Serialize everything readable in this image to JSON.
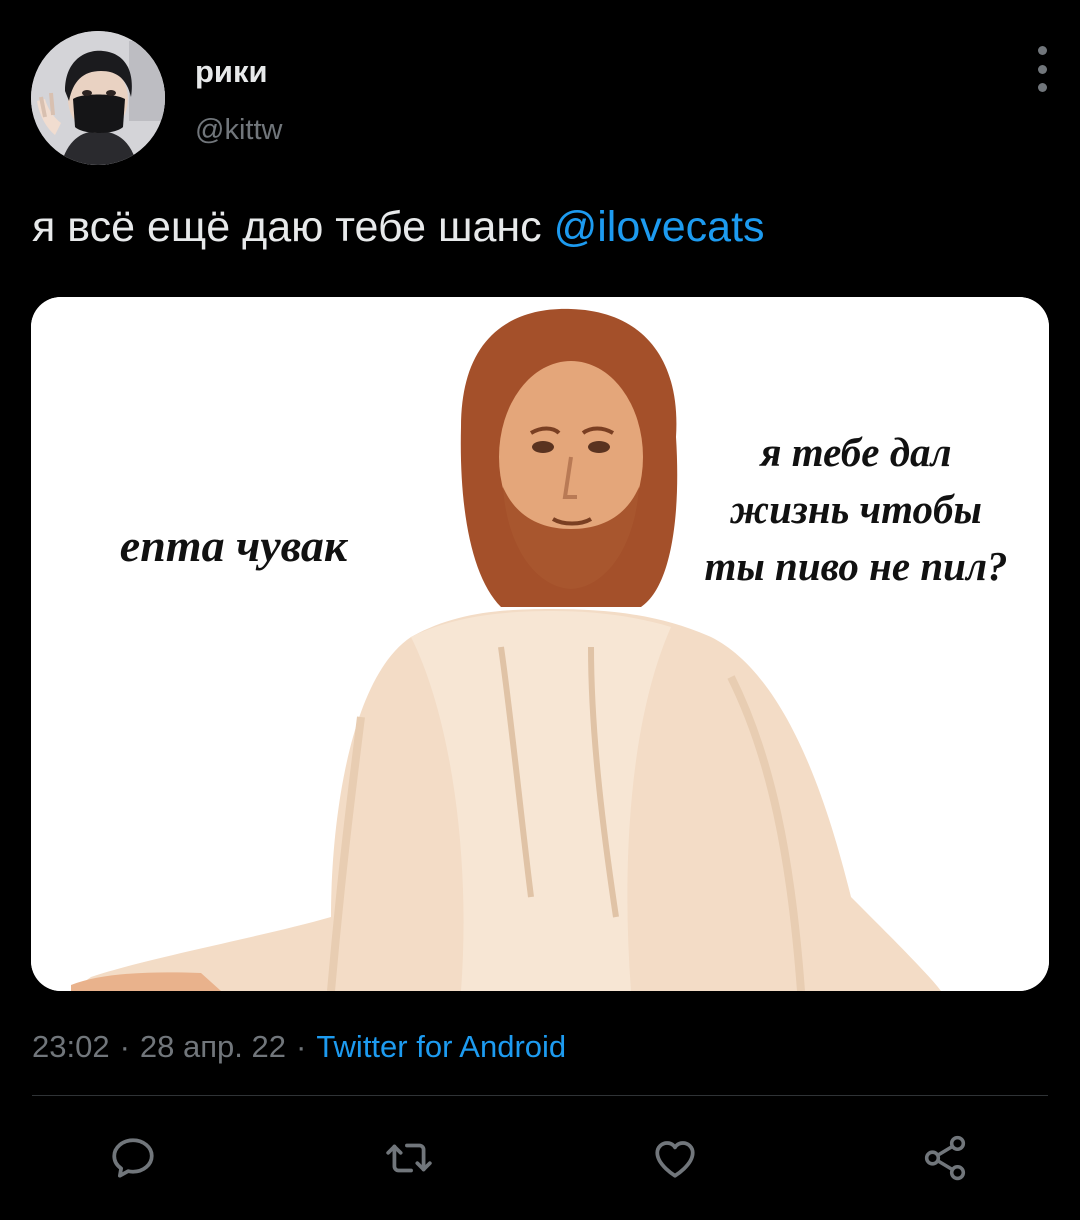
{
  "author": {
    "display_name": "рики",
    "handle": "@kittw",
    "avatar_icon": "avatar-photo"
  },
  "tweet": {
    "text": "я всё ещё даю тебе шанс ",
    "mention": "@ilovecats"
  },
  "media": {
    "left_caption": "епта чувак",
    "right_caption": [
      "я тебе дал",
      "жизнь чтобы",
      "ты пиво не пил?"
    ]
  },
  "meta": {
    "time": "23:02",
    "date": "28 апр. 22",
    "separator": "·",
    "source": "Twitter for Android"
  },
  "actions": {
    "icons": [
      "reply-icon",
      "retweet-icon",
      "like-icon",
      "share-icon"
    ]
  },
  "colors": {
    "background": "#000000",
    "primary_text": "#e7e9ea",
    "secondary_text": "#71767b",
    "accent": "#1d9bf0",
    "divider": "#2f3336"
  }
}
